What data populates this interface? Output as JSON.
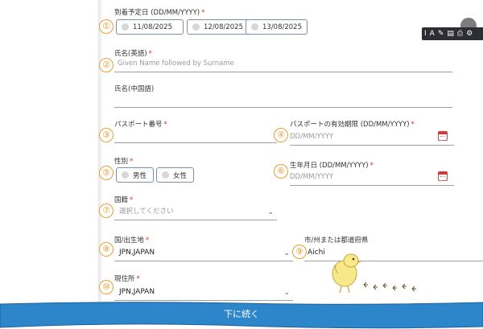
{
  "arrival": {
    "label": "到着予定日 (DD/MM/YYYY)",
    "required": "*",
    "num": "①",
    "options": [
      "11/08/2025",
      "12/08/2025",
      "13/08/2025"
    ]
  },
  "name_en": {
    "label": "氏名(英語)",
    "required": "*",
    "num": "②",
    "placeholder": "Given Name followed by Surname"
  },
  "name_cn": {
    "label": "氏名(中国語)"
  },
  "passport_no": {
    "label": "パスポート番号",
    "required": "*",
    "num": "③"
  },
  "passport_exp": {
    "label": "パスポートの有効期限 (DD/MM/YYYY)",
    "required": "*",
    "num": "④",
    "placeholder": "DD/MM/YYYY"
  },
  "gender": {
    "label": "性別",
    "required": "*",
    "num": "⑤",
    "options": [
      "男性",
      "女性"
    ]
  },
  "birth": {
    "label": "生年月日 (DD/MM/YYYY)",
    "required": "*",
    "num": "⑥",
    "placeholder": "DD/MM/YYYY"
  },
  "nationality": {
    "label": "国籍",
    "required": "*",
    "num": "⑦",
    "placeholder": "選択してください"
  },
  "birthplace": {
    "label": "国/出生地",
    "required": "*",
    "num": "⑧",
    "value": "JPN,JAPAN"
  },
  "prefecture": {
    "label": "市/州または都道府県",
    "num": "⑨",
    "value": "Aichi"
  },
  "residence": {
    "label": "現住所",
    "required": "*",
    "num": "⑩",
    "value": "JPN,JAPAN"
  },
  "continue_button": {
    "label": "下に続く"
  },
  "toolbar": {
    "items": [
      "I",
      "A",
      "✎",
      "▤",
      "⎙",
      "⚙"
    ]
  },
  "colors": {
    "accent_orange": "#f29b2e",
    "required_red": "#d9301e",
    "banner_blue": "#2c86c9"
  }
}
